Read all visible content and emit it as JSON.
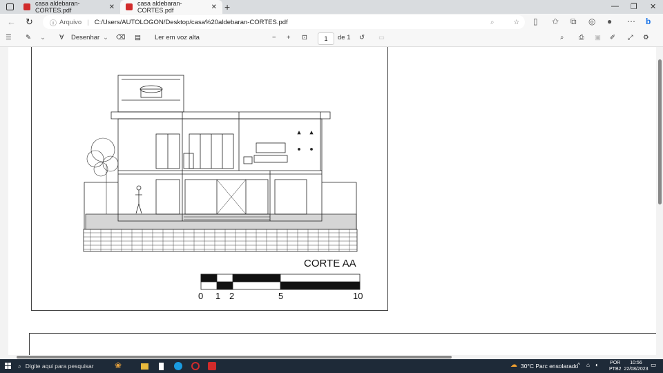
{
  "browser": {
    "tabs": [
      {
        "title": "casa aldebaran-CORTES.pdf",
        "active": false
      },
      {
        "title": "casa aldebaran-CORTES.pdf",
        "active": true
      }
    ],
    "new_tab_label": "+",
    "address": {
      "scheme_label": "Arquivo",
      "url": "C:/Users/AUTOLOGON/Desktop/casa%20aldebaran-CORTES.pdf"
    }
  },
  "pdf_toolbar": {
    "draw_label": "Desenhar",
    "read_aloud_label": "Ler em voz alta",
    "page_current": "1",
    "page_total_label": "de 1"
  },
  "drawing": {
    "section_title": "CORTE AA",
    "scale_labels": [
      "0",
      "1",
      "2",
      "5",
      "10"
    ]
  },
  "taskbar": {
    "search_placeholder": "Digite aqui para pesquisar",
    "weather": "30°C  Parc ensolarado",
    "language": "POR",
    "language_sub": "PTB2",
    "time": "10:56",
    "date": "22/08/2023"
  },
  "colors": {
    "tab_strip": "#d9dcdf",
    "toolbar": "#f7f7f7",
    "taskbar": "#1e2a38",
    "pdf_red": "#d12b2b",
    "edge_blue": "#1a73e8"
  }
}
